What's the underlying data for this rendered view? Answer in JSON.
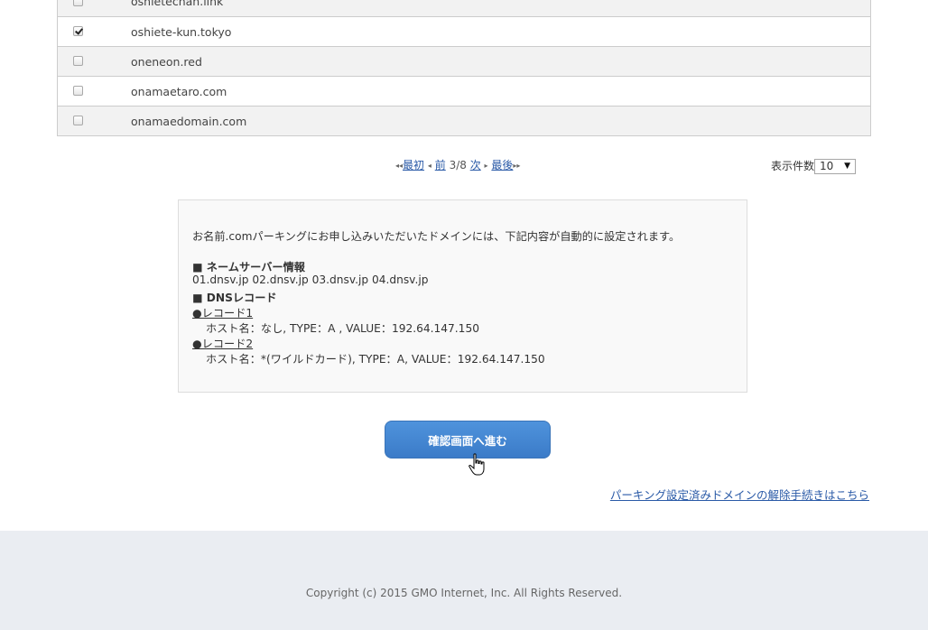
{
  "domains": [
    {
      "name": "oshietechan.link",
      "checked": false
    },
    {
      "name": "oshiete-kun.tokyo",
      "checked": true
    },
    {
      "name": "oneneon.red",
      "checked": false
    },
    {
      "name": "onamaetaro.com",
      "checked": false
    },
    {
      "name": "onamaedomain.com",
      "checked": false
    }
  ],
  "pager": {
    "first_arrow": "◂◂",
    "first": "最初",
    "prev_arrow": "◂",
    "prev": "前",
    "page": "3/8",
    "next": "次",
    "next_arrow": "▸",
    "last": "最後",
    "last_arrow": "▸▸"
  },
  "per_page": {
    "label": "表示件数",
    "value": "10",
    "caret": "▼"
  },
  "info": {
    "intro": "お名前.comパーキングにお申し込みいただいたドメインには、下記内容が自動的に設定されます。",
    "ns_heading": "■ ネームサーバー情報",
    "ns_values": "01.dnsv.jp 02.dnsv.jp 03.dnsv.jp 04.dnsv.jp",
    "dns_heading": "■ DNSレコード",
    "record1_title": "●レコード1",
    "record1_value": "ホスト名：なし, TYPE：A , VALUE：192.64.147.150",
    "record2_title": "●レコード2",
    "record2_value": "ホスト名：*(ワイルドカード), TYPE：A, VALUE：192.64.147.150"
  },
  "confirm_button": "確認画面へ進む",
  "release_link": "パーキング設定済みドメインの解除手続きはこちら",
  "footer": {
    "copyright": "Copyright (c) 2015 GMO Internet, Inc. All Rights Reserved."
  }
}
